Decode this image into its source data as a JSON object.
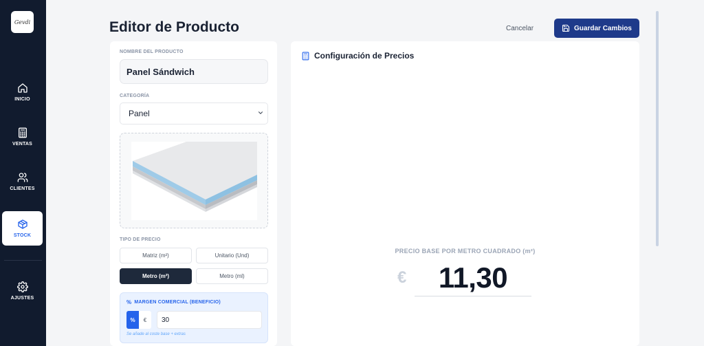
{
  "sidebar": {
    "logo_text": "Gevdi",
    "items": [
      {
        "label": "INICIO",
        "icon": "home-icon"
      },
      {
        "label": "VENTAS",
        "icon": "calculator-icon"
      },
      {
        "label": "CLIENTES",
        "icon": "users-icon"
      },
      {
        "label": "STOCK",
        "icon": "box-icon",
        "active": true
      },
      {
        "label": "AJUSTES",
        "icon": "gear-icon"
      }
    ]
  },
  "header": {
    "title": "Editor de Producto",
    "cancel_label": "Cancelar",
    "save_label": "Guardar Cambios"
  },
  "product": {
    "name_label": "NOMBRE DEL PRODUCTO",
    "name_value": "Panel Sándwich",
    "category_label": "CATEGORÍA",
    "category_value": "Panel",
    "price_type_label": "TIPO DE PRECIO",
    "price_types": [
      {
        "label": "Matriz (m²)",
        "active": false
      },
      {
        "label": "Unitario (Und)",
        "active": false
      },
      {
        "label": "Metro (m²)",
        "active": true
      },
      {
        "label": "Metro (ml)",
        "active": false
      }
    ],
    "margin": {
      "title": "MARGEN COMERCIAL (BENEFICIO)",
      "pct_label": "%",
      "eur_label": "€",
      "value": "30",
      "hint": "Se añade al coste base + extras"
    }
  },
  "pricing": {
    "title": "Configuración de Precios",
    "base_label": "PRECIO BASE POR METRO CUADRADO (m²)",
    "currency": "€",
    "base_value": "11,30"
  },
  "colors": {
    "sidebar_bg": "#111b2e",
    "accent": "#2563eb",
    "primary_button": "#1e3a8a"
  }
}
